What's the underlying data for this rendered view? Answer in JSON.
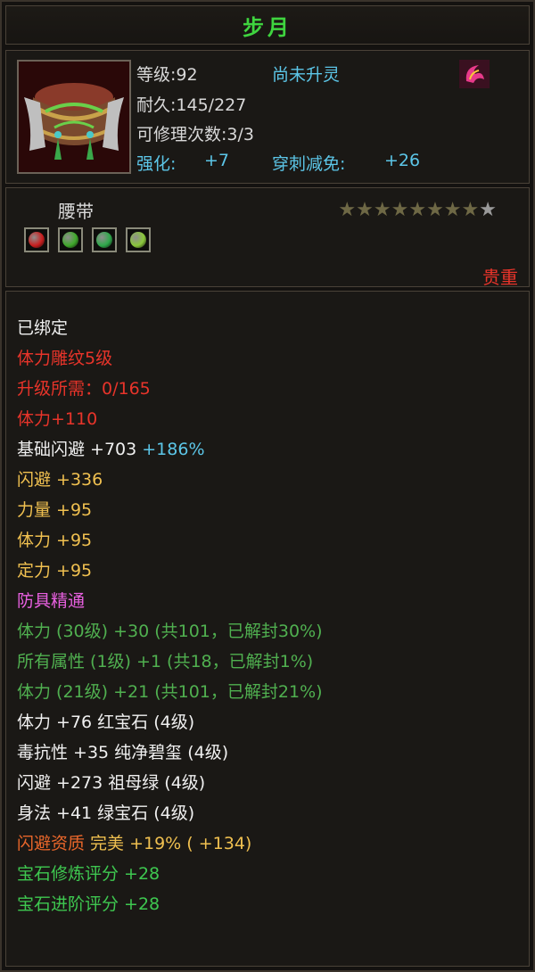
{
  "title": "步月",
  "item": {
    "level": "等级:92",
    "spirit": "尚未升灵",
    "durability": "耐久:145/227",
    "repairs": "可修理次数:3/3",
    "enhance_label": "强化:",
    "enhance_value": "+7",
    "pierce_label": "穿刺减免:",
    "pierce_value": "+26",
    "type": "腰带",
    "rarity": "贵重"
  },
  "stars": {
    "filled": 8,
    "total": 9
  },
  "gems": [
    {
      "name": "red-gem-icon",
      "color": "#c81e1e"
    },
    {
      "name": "green-gem-icon",
      "color": "#3ea82a"
    },
    {
      "name": "green-gem-icon",
      "color": "#2ea84a"
    },
    {
      "name": "emerald-gem-icon",
      "color": "#8ac83a"
    }
  ],
  "lines": [
    {
      "segments": [
        {
          "text": "已绑定",
          "cls": "c-white"
        }
      ]
    },
    {
      "segments": [
        {
          "text": "体力雕纹5级",
          "cls": "c-red"
        }
      ]
    },
    {
      "segments": [
        {
          "text": "升级所需：0/165",
          "cls": "c-red"
        }
      ]
    },
    {
      "segments": [
        {
          "text": "体力+110",
          "cls": "c-red"
        }
      ]
    },
    {
      "segments": [
        {
          "text": "基础闪避 +703 ",
          "cls": "c-white"
        },
        {
          "text": "+186%",
          "cls": "c-cyan"
        }
      ]
    },
    {
      "segments": [
        {
          "text": "闪避 +336",
          "cls": "c-orange"
        }
      ]
    },
    {
      "segments": [
        {
          "text": "力量 +95",
          "cls": "c-orange"
        }
      ]
    },
    {
      "segments": [
        {
          "text": "体力 +95",
          "cls": "c-orange"
        }
      ]
    },
    {
      "segments": [
        {
          "text": "定力 +95",
          "cls": "c-orange"
        }
      ]
    },
    {
      "segments": [
        {
          "text": "防具精通",
          "cls": "c-pink"
        }
      ]
    },
    {
      "segments": [
        {
          "text": "体力 (30级) +30 (共101，已解封30%)",
          "cls": "c-greendim"
        }
      ]
    },
    {
      "segments": [
        {
          "text": "所有属性 (1级) +1 (共18，已解封1%)",
          "cls": "c-greendim"
        }
      ]
    },
    {
      "segments": [
        {
          "text": "体力 (21级) +21 (共101，已解封21%)",
          "cls": "c-greendim"
        }
      ]
    },
    {
      "segments": [
        {
          "text": "体力 +76  红宝石 (4级)",
          "cls": "c-white"
        }
      ]
    },
    {
      "segments": [
        {
          "text": "毒抗性 +35  纯净碧玺 (4级)",
          "cls": "c-white"
        }
      ]
    },
    {
      "segments": [
        {
          "text": "闪避 +273  祖母绿 (4级)",
          "cls": "c-white"
        }
      ]
    },
    {
      "segments": [
        {
          "text": "身法 +41  绿宝石 (4级)",
          "cls": "c-white"
        }
      ]
    },
    {
      "segments": [
        {
          "text": "闪避资质  ",
          "cls": "c-orred"
        },
        {
          "text": "完美 +19% ( +134)",
          "cls": "c-orange"
        }
      ]
    },
    {
      "segments": [
        {
          "text": "宝石修炼评分 +28",
          "cls": "c-green"
        }
      ]
    },
    {
      "segments": [
        {
          "text": "宝石进阶评分 +28",
          "cls": "c-green"
        }
      ]
    }
  ]
}
